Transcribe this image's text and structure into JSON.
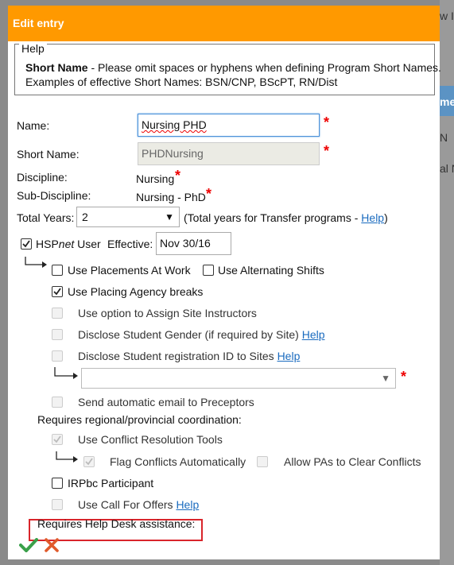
{
  "background": {
    "fragments": [
      "w In",
      "me",
      "N",
      "al N"
    ]
  },
  "dialog": {
    "title": "Edit entry",
    "help": {
      "legend": "Help",
      "bold": "Short Name",
      "line1_rest": " - Please omit spaces or hyphens when defining Program Short Names.",
      "line2": "Examples of effective Short Names: BSN/CNP, BScPT, RN/Dist"
    },
    "fields": {
      "name_label": "Name:",
      "name_value": "Nursing PHD",
      "short_name_label": "Short Name:",
      "short_name_value": "PHDNursing",
      "discipline_label": "Discipline:",
      "discipline_value": "Nursing",
      "subdiscipline_label": "Sub-Discipline:",
      "subdiscipline_value": "Nursing - PhD",
      "total_years_label": "Total Years:",
      "total_years_value": "2",
      "total_years_note": "(Total years for Transfer programs - ",
      "total_years_help": "Help",
      "total_years_close": ")",
      "required_mark": "*"
    },
    "hspnet": {
      "label_pre": "HSP",
      "label_em": "net",
      "label_post": " User",
      "effective_label": "Effective:",
      "effective_value": "Nov 30/16"
    },
    "options": {
      "use_placements_at_work": "Use Placements At Work",
      "use_alternating_shifts": "Use Alternating Shifts",
      "use_placing_agency_breaks": "Use Placing Agency breaks",
      "assign_site_instructors": "Use option to Assign Site Instructors",
      "disclose_gender": "Disclose Student Gender (if required by Site) ",
      "disclose_gender_help": "Help",
      "disclose_registration": "Disclose Student registration ID to Sites ",
      "disclose_registration_help": "Help",
      "send_email_preceptors": "Send automatic email to Preceptors",
      "regional_heading": "Requires regional/provincial coordination:",
      "conflict_resolution": "Use Conflict Resolution Tools",
      "flag_conflicts": "Flag Conflicts Automatically",
      "allow_pas": "Allow PAs to Clear Conflicts",
      "irpbc": "IRPbc Participant",
      "call_for_offers": "Use Call For Offers ",
      "call_for_offers_help": "Help",
      "helpdesk_heading": "Requires Help Desk assistance:"
    },
    "colors": {
      "titlebar": "#ff9900",
      "required": "#e00000",
      "save": "#3aa04a",
      "cancel": "#e05a2b",
      "highlight": "#d9252b"
    }
  }
}
